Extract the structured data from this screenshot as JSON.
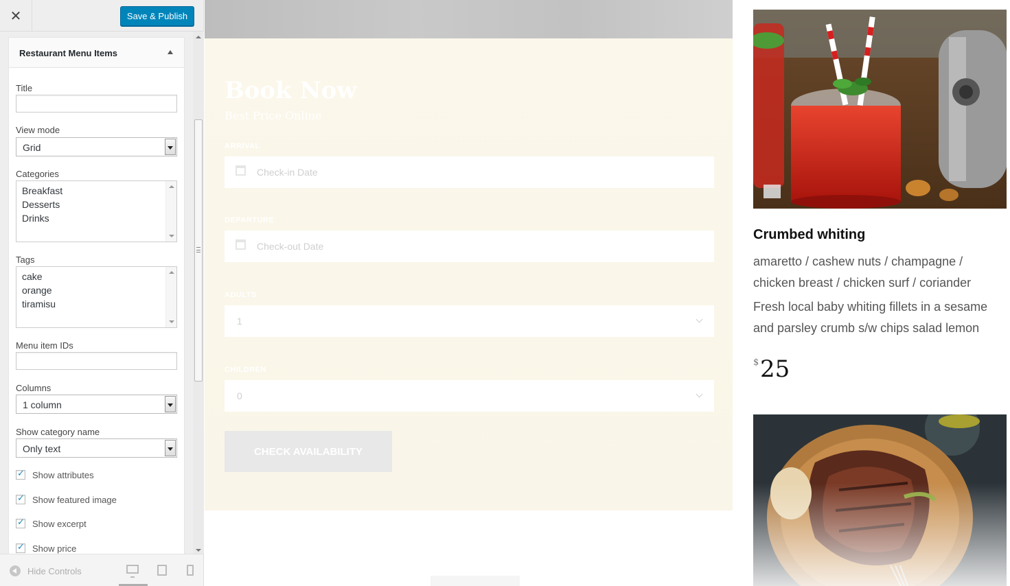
{
  "header": {
    "close_glyph": "✕",
    "save_label": "Save & Publish"
  },
  "widget": {
    "title": "Restaurant Menu Items",
    "fields": {
      "title_label": "Title",
      "title_value": "",
      "view_mode_label": "View mode",
      "view_mode_value": "Grid",
      "categories_label": "Categories",
      "categories": [
        "Breakfast",
        "Desserts",
        "Drinks"
      ],
      "tags_label": "Tags",
      "tags": [
        "cake",
        "orange",
        "tiramisu"
      ],
      "menu_ids_label": "Menu item IDs",
      "menu_ids_value": "",
      "columns_label": "Columns",
      "columns_value": "1 column",
      "show_category_label": "Show category name",
      "show_category_value": "Only text"
    },
    "checkboxes": [
      {
        "label": "Show attributes",
        "checked": true
      },
      {
        "label": "Show featured image",
        "checked": true
      },
      {
        "label": "Show excerpt",
        "checked": true
      },
      {
        "label": "Show price",
        "checked": true
      }
    ]
  },
  "footer": {
    "hide_controls": "Hide Controls"
  },
  "booking": {
    "title": "Book Now",
    "subtitle": "Best Price Online",
    "arrival_label": "ARRIVAL",
    "arrival_placeholder": "Check-in Date",
    "departure_label": "DEPARTURE",
    "departure_placeholder": "Check-out Date",
    "adults_label": "ADULTS",
    "adults_value": "1",
    "children_label": "CHILDREN",
    "children_value": "0",
    "button_label": "CHECK AVAILABILITY"
  },
  "menu_item": {
    "name": "Crumbed whiting",
    "ingredients": "amaretto / cashew nuts / champagne / chicken breast / chicken surf / coriander",
    "description": "Fresh local baby whiting fillets in a sesame and parsley crumb s/w chips salad lemon",
    "currency": "$",
    "price": "25"
  },
  "colors": {
    "accent": "#0085ba",
    "booking_bg": "#fbf7ea",
    "button_bg": "#e8e8e8"
  }
}
